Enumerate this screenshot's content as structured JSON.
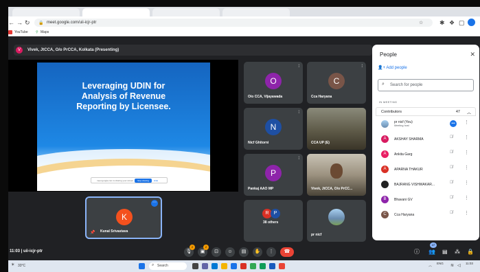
{
  "browser": {
    "url": "meet.google.com/uii-icjr-ptr",
    "bookmarks": [
      "YouTube",
      "Maps"
    ]
  },
  "meet": {
    "presenting_banner": "Vivek, JtCCA, O/o PrCCA, Kolkata (Presenting)",
    "presenter_initial": "V",
    "slide": {
      "title_lines": [
        "Leveraging UDIN for",
        "Analysis of Revenue",
        "Reporting by Licensee."
      ],
      "share_bar_message": "meet.google.com is sharing your screen.",
      "share_bar_button": "Stop sharing",
      "share_bar_hide": "Hide"
    },
    "self_tile": {
      "initial": "K",
      "name": "Kunal Srivastava"
    },
    "tiles": [
      {
        "initial": "O",
        "name": "O/o CCA, Vijayawada",
        "color": "#8e24aa"
      },
      {
        "initial": "C",
        "name": "Cca Haryana",
        "color": "#795548"
      },
      {
        "initial": "N",
        "name": "Nicf Ghitorni",
        "color": "#1e4fa3"
      },
      {
        "initial": "",
        "name": "CCA UP (E)",
        "color": "#6b6b5a"
      },
      {
        "initial": "P",
        "name": "Pankaj AAO MP",
        "color": "#8e24aa"
      },
      {
        "initial": "",
        "name": "Vivek, JtCCA, O/o PrCC...",
        "color": "#7a7060"
      },
      {
        "initial": "",
        "name": "38 others",
        "color": "#3c4043"
      },
      {
        "initial": "",
        "name": "pr nicf",
        "color": "#3c4043"
      }
    ],
    "others_avatars": [
      "R",
      "P"
    ],
    "time_code": "11:03  |  uii-icjr-ptr",
    "reaction_badge": "2",
    "chat_badge": "2",
    "participants_badge": "47"
  },
  "people_panel": {
    "title": "People",
    "add_people": "Add people",
    "search_placeholder": "Search for people",
    "in_meeting": "IN MEETING",
    "contributors_label": "Contributors",
    "contributors_count": "47",
    "people": [
      {
        "name": "pr nicf (You)",
        "sub": "Meeting host",
        "initial": "",
        "color": "#6a8caf"
      },
      {
        "name": "AKSHAY SHARMA",
        "sub": "",
        "initial": "A",
        "color": "#d81b60"
      },
      {
        "name": "Ankita Garg",
        "sub": "",
        "initial": "A",
        "color": "#e91e63"
      },
      {
        "name": "APARNA THAKUR",
        "sub": "",
        "initial": "A",
        "color": "#d93025"
      },
      {
        "name": "BAJRANG VISHWAKAR...",
        "sub": "",
        "initial": "",
        "color": "#222222"
      },
      {
        "name": "Bhavani GV",
        "sub": "",
        "initial": "B",
        "color": "#8e24aa"
      },
      {
        "name": "Cca Haryana",
        "sub": "",
        "initial": "C",
        "color": "#795548"
      }
    ]
  },
  "taskbar": {
    "weather": "33°C",
    "search": "Search",
    "lang": "ENG",
    "time": "11:03"
  }
}
